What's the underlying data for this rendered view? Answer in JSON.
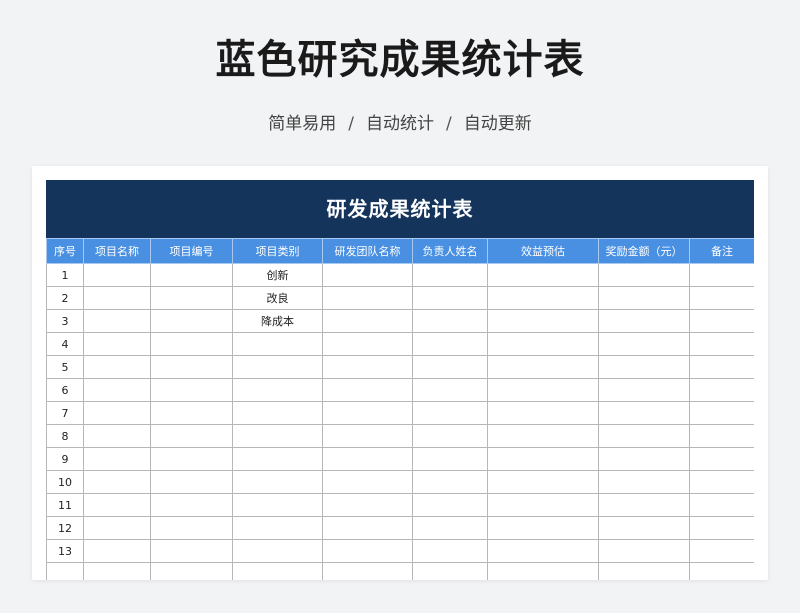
{
  "header": {
    "title": "蓝色研究成果统计表",
    "subtitle_items": [
      "简单易用",
      "自动统计",
      "自动更新"
    ],
    "separator": "/"
  },
  "sheet": {
    "title": "研发成果统计表",
    "columns": [
      "序号",
      "项目名称",
      "项目编号",
      "项目类别",
      "研发团队名称",
      "负责人姓名",
      "效益预估",
      "奖励金额（元）",
      "备注"
    ],
    "rows": [
      [
        "1",
        "",
        "",
        "创新",
        "",
        "",
        "",
        "",
        ""
      ],
      [
        "2",
        "",
        "",
        "改良",
        "",
        "",
        "",
        "",
        ""
      ],
      [
        "3",
        "",
        "",
        "降成本",
        "",
        "",
        "",
        "",
        ""
      ],
      [
        "4",
        "",
        "",
        "",
        "",
        "",
        "",
        "",
        ""
      ],
      [
        "5",
        "",
        "",
        "",
        "",
        "",
        "",
        "",
        ""
      ],
      [
        "6",
        "",
        "",
        "",
        "",
        "",
        "",
        "",
        ""
      ],
      [
        "7",
        "",
        "",
        "",
        "",
        "",
        "",
        "",
        ""
      ],
      [
        "8",
        "",
        "",
        "",
        "",
        "",
        "",
        "",
        ""
      ],
      [
        "9",
        "",
        "",
        "",
        "",
        "",
        "",
        "",
        ""
      ],
      [
        "10",
        "",
        "",
        "",
        "",
        "",
        "",
        "",
        ""
      ],
      [
        "11",
        "",
        "",
        "",
        "",
        "",
        "",
        "",
        ""
      ],
      [
        "12",
        "",
        "",
        "",
        "",
        "",
        "",
        "",
        ""
      ],
      [
        "13",
        "",
        "",
        "",
        "",
        "",
        "",
        "",
        ""
      ],
      [
        "",
        "",
        "",
        "",
        "",
        "",
        "",
        "",
        ""
      ]
    ]
  },
  "colors": {
    "title_bar": "#14345c",
    "header_row": "#4a90e2",
    "background": "#f2f3f5"
  }
}
